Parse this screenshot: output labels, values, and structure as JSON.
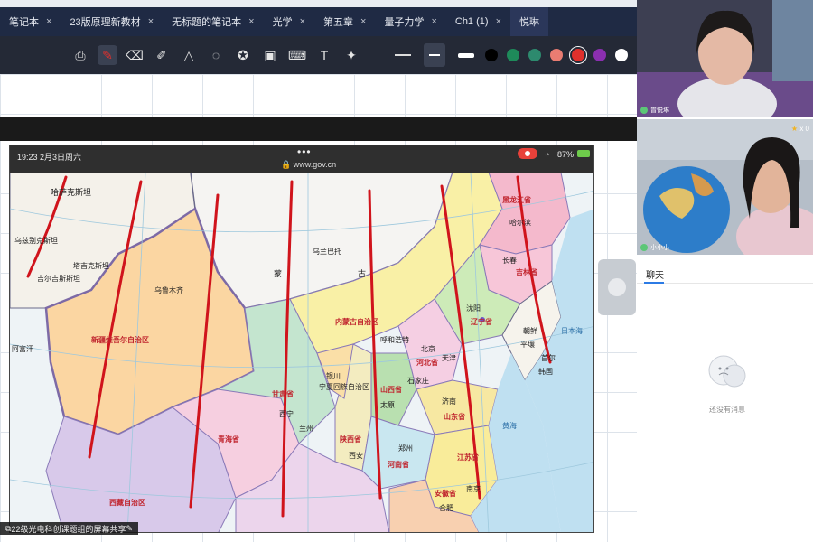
{
  "tabs": [
    {
      "label": "笔记本",
      "active": false
    },
    {
      "label": "23版原理新教材",
      "active": false
    },
    {
      "label": "无标题的笔记本",
      "active": false
    },
    {
      "label": "光学",
      "active": false
    },
    {
      "label": "第五章",
      "active": false
    },
    {
      "label": "量子力学",
      "active": false
    },
    {
      "label": "Ch1 (1)",
      "active": false
    },
    {
      "label": "悦琳",
      "active": true
    }
  ],
  "tab_close_glyph": "×",
  "toolbar": {
    "tools": [
      "screenshot-icon",
      "pen-icon",
      "eraser-icon",
      "highlighter-icon",
      "shapes-icon",
      "lasso-icon",
      "sticker-icon",
      "image-icon",
      "keyboard-icon",
      "textbox-icon",
      "laser-pointer-icon"
    ],
    "colors": [
      "#000000",
      "#1e8a5a",
      "#2d8a6e",
      "#e97c72",
      "#e0302c",
      "#8b2fb0",
      "#ffffff",
      "#9fd3f0",
      "#ffffff"
    ],
    "selected_color": "#e0302c"
  },
  "phone": {
    "time": "19:23",
    "date": "2月3日周六",
    "dots": "•••",
    "url": "www.gov.cn",
    "battery": "87%"
  },
  "map_labels": {
    "kazakhstan": "哈萨克斯坦",
    "kyrgyz": "吉尔吉斯斯坦",
    "tajik": "塔吉克斯坦",
    "afghan": "阿富汗",
    "uzbek": "乌兹别克斯坦",
    "mongolia_a": "蒙",
    "mongolia_b": "古",
    "ulaanbaatar": "乌兰巴托",
    "urumqi": "乌鲁木齐",
    "xinjiang": "新疆维吾尔自治区",
    "tibet": "西藏自治区",
    "qinghai": "青海省",
    "gansu": "甘肃省",
    "innermongolia": "内蒙古自治区",
    "heilongjiang": "黑龙江省",
    "harbin": "哈尔滨",
    "jilin": "吉林省",
    "changchun": "长春",
    "liaoning": "辽宁省",
    "shenyang": "沈阳",
    "hebei": "河北省",
    "beijing": "北京",
    "tianjin": "天津",
    "shanxi": "山西省",
    "taiyuan": "太原",
    "shijiazhuang": "石家庄",
    "hohhot": "呼和浩特",
    "shandong": "山东省",
    "jinan": "济南",
    "henan": "河南省",
    "zhengzhou": "郑州",
    "shaanxi": "陕西省",
    "xian": "西安",
    "ningxia": "宁夏回族自治区",
    "yinchuan": "银川",
    "lanzhou": "兰州",
    "xining": "西宁",
    "jiangsu": "江苏省",
    "anhui": "安徽省",
    "hefei": "合肥",
    "nanjing": "南京",
    "korea_n": "朝鲜",
    "pyongyang": "平壤",
    "korea_s": "韩国",
    "seoul": "首尔",
    "yellowsea": "黄海",
    "eastsea": "日本海"
  },
  "share_caption": "22级光电科创课题组的屏幕共享",
  "videos": [
    {
      "name": "曾悦琳"
    },
    {
      "name": "小小小",
      "stars": "x 0"
    }
  ],
  "chat": {
    "title": "聊天",
    "empty_text": "还没有消息"
  }
}
